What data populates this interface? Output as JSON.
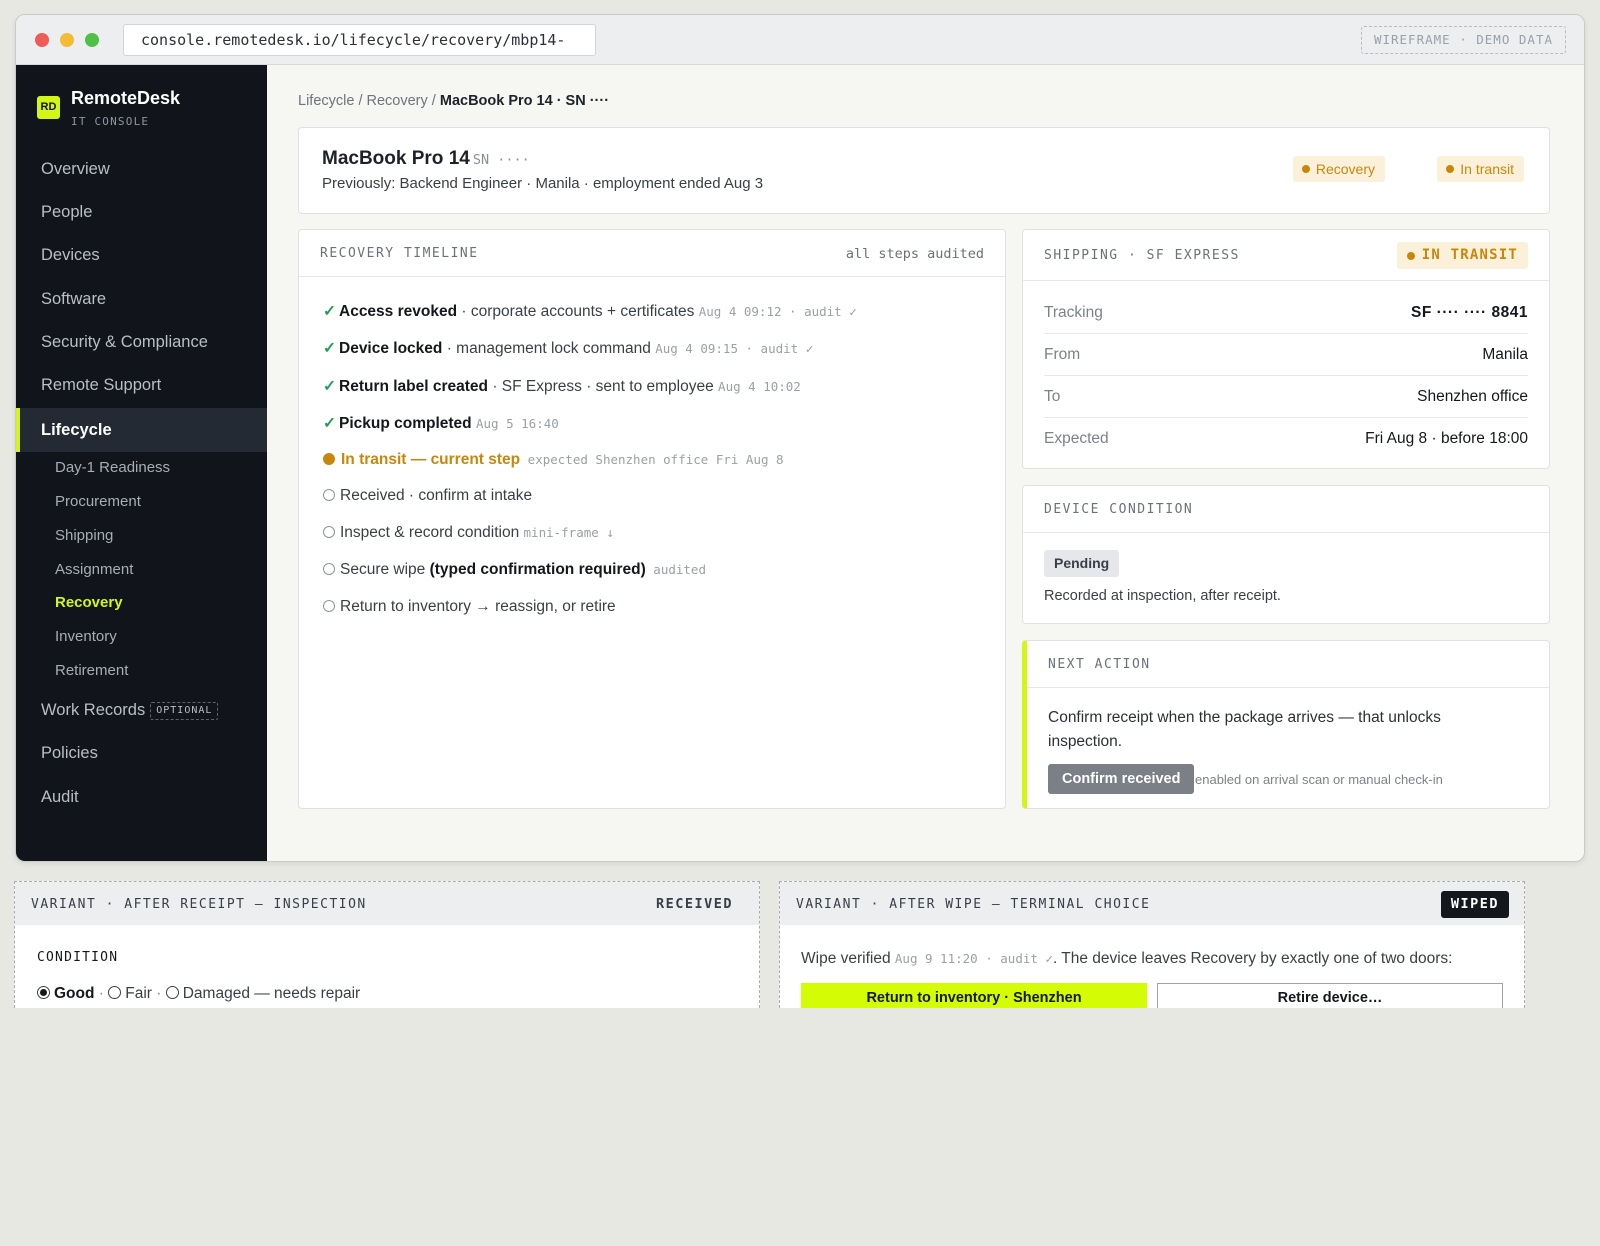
{
  "browser": {
    "url": "console.remotedesk.io/lifecycle/recovery/mbp14-····",
    "demo_tag": "WIREFRAME · DEMO DATA"
  },
  "brand": {
    "logo": "RD",
    "name": "RemoteDesk",
    "subtitle": "IT CONSOLE"
  },
  "nav": {
    "items": [
      {
        "label": "Overview"
      },
      {
        "label": "People"
      },
      {
        "label": "Devices"
      },
      {
        "label": "Software"
      },
      {
        "label": "Security & Compliance"
      },
      {
        "label": "Remote Support"
      },
      {
        "label": "Lifecycle",
        "active": true
      }
    ],
    "sub_items": [
      {
        "label": "Day-1 Readiness"
      },
      {
        "label": "Procurement"
      },
      {
        "label": "Shipping"
      },
      {
        "label": "Assignment"
      },
      {
        "label": "Recovery",
        "active": true
      },
      {
        "label": "Inventory"
      },
      {
        "label": "Retirement"
      }
    ],
    "after": [
      {
        "label": "Work Records",
        "tag": "OPTIONAL"
      },
      {
        "label": "Policies"
      },
      {
        "label": "Audit"
      }
    ]
  },
  "breadcrumb": {
    "first": "Lifecycle",
    "sep": "/",
    "second": "Recovery",
    "current": "MacBook Pro 14 · SN  ····"
  },
  "device": {
    "title": "MacBook Pro 14",
    "sn": "SN  ····",
    "subtitle": "Previously: Backend Engineer · Manila · employment ended Aug 3",
    "pills": [
      "Recovery",
      "In transit"
    ]
  },
  "timeline": {
    "title": "RECOVERY TIMELINE",
    "meta": "all steps audited",
    "steps": [
      {
        "mark": "✓",
        "bold": "Access revoked",
        "text": " · corporate accounts + certificates ",
        "ts": "Aug 4 09:12 · audit ✓"
      },
      {
        "mark": "✓",
        "bold": "Device locked",
        "text": " · management lock command ",
        "ts": "Aug 4 09:15 · audit ✓"
      },
      {
        "mark": "✓",
        "bold": "Return label created",
        "text": " · SF Express · sent to employee ",
        "ts": "Aug 4 10:02"
      },
      {
        "mark": "✓",
        "bold": "Pickup completed",
        "text": " ",
        "ts": "Aug 5 16:40"
      },
      {
        "current": "In transit — current step",
        "ts": " expected Shenzhen office Fri Aug 8"
      },
      {
        "text": "Received · confirm at intake"
      },
      {
        "text": "Inspect & record condition ",
        "ts": "mini-frame ↓"
      },
      {
        "text": "Secure wipe ",
        "bold": "(typed confirmation required)",
        "ts": " audited"
      },
      {
        "text": "Return to inventory → reassign, or retire"
      }
    ]
  },
  "shipping": {
    "title": "SHIPPING · SF EXPRESS",
    "badge": "IN TRANSIT",
    "rows": [
      {
        "k": "Tracking",
        "v": "SF ···· ···· 8841"
      },
      {
        "k": "From",
        "v": "Manila"
      },
      {
        "k": "To",
        "v": "Shenzhen office"
      },
      {
        "k": "Expected",
        "v": "Fri Aug 8 · before 18:00"
      }
    ]
  },
  "condition": {
    "title": "DEVICE CONDITION",
    "badge": "Pending",
    "note": "Recorded at inspection, after receipt."
  },
  "next_action": {
    "title": "NEXT ACTION",
    "body": "Confirm receipt when the package arrives — that unlocks inspection.",
    "button": "Confirm received",
    "button_note": "enabled on arrival scan or manual check-in"
  },
  "variant_receipt": {
    "title": "VARIANT · AFTER RECEIPT — INSPECTION",
    "tag": "RECEIVED",
    "label": "CONDITION",
    "options": [
      "Good",
      "Fair",
      "Damaged — needs repair"
    ],
    "selected": "Good"
  },
  "variant_wipe": {
    "title": "VARIANT · AFTER WIPE — TERMINAL CHOICE",
    "tag": "WIPED",
    "line_start": "Wipe verified ",
    "line_ts": "Aug 9 11:20 · audit ✓",
    "line_end": ". The device leaves Recovery by exactly one of two doors:",
    "primary": "Return to inventory · Shenzhen",
    "secondary": "Retire device…"
  },
  "colors": {
    "accent": "#d4f616",
    "warning": "#c8870b",
    "success": "#1f9d57",
    "sidebar": "#11141a"
  }
}
